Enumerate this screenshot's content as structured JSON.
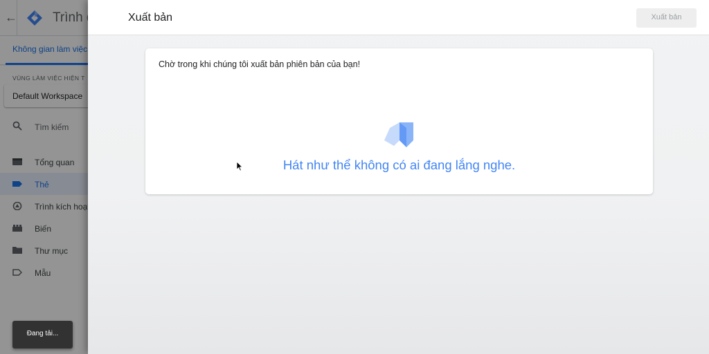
{
  "app": {
    "title": "Trình q",
    "tabs": {
      "workspace": "Không gian làm việc"
    },
    "sidebar": {
      "workspace_caption": "VÙNG LÀM VIỆC HIỆN T",
      "workspace_value": "Default Workspace",
      "search_label": "Tìm kiếm",
      "items": [
        {
          "label": "Tổng quan",
          "icon": "overview-icon",
          "active": false
        },
        {
          "label": "Thẻ",
          "icon": "tag-icon",
          "active": true
        },
        {
          "label": "Trình kích hoạt",
          "icon": "trigger-icon",
          "active": false
        },
        {
          "label": "Biến",
          "icon": "variable-icon",
          "active": false
        },
        {
          "label": "Thư mục",
          "icon": "folder-icon",
          "active": false
        },
        {
          "label": "Mẫu",
          "icon": "template-icon",
          "active": false
        }
      ]
    },
    "toast": "Đang tải..."
  },
  "panel": {
    "title": "Xuất bản",
    "publish_button": "Xuất bản",
    "message": "Chờ trong khi chúng tôi xuất bản phiên bản của bạn!",
    "quote": "Hát như thể không có ai đang lắng nghe."
  },
  "colors": {
    "accent": "#1a73e8",
    "quote": "#4285f4",
    "toast_bg": "#323232"
  }
}
